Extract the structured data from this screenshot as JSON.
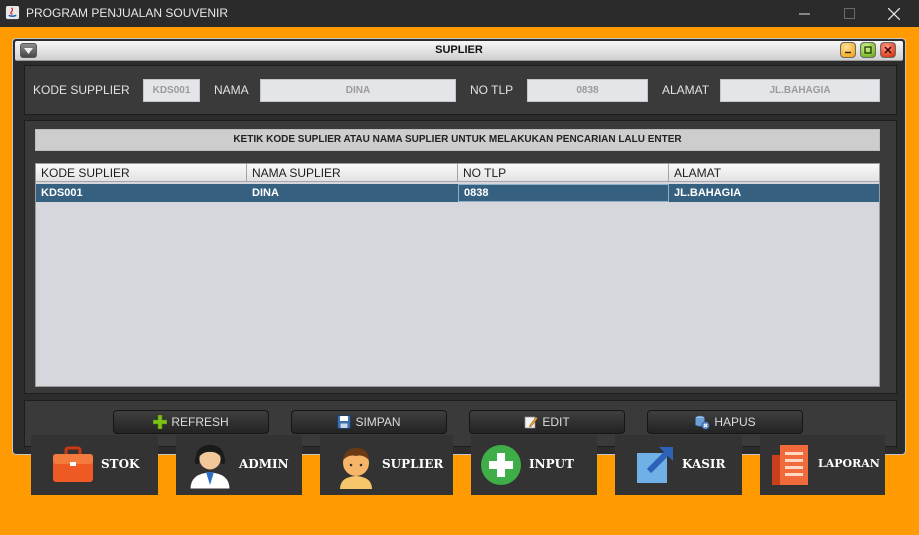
{
  "window": {
    "title": "PROGRAM PENJUALAN SOUVENIR"
  },
  "frame": {
    "title": "SUPLIER"
  },
  "form": {
    "kode_label": "KODE SUPPLIER",
    "kode_value": "KDS001",
    "nama_label": "NAMA",
    "nama_value": "DINA",
    "tlp_label": "NO TLP",
    "tlp_value": "0838",
    "alamat_label": "ALAMAT",
    "alamat_value": "JL.BAHAGIA"
  },
  "search_hint": "KETIK KODE SUPLIER ATAU NAMA SUPLIER UNTUK MELAKUKAN PENCARIAN LALU ENTER",
  "table": {
    "columns": [
      "KODE SUPLIER",
      "NAMA SUPLIER",
      "NO TLP",
      "ALAMAT"
    ],
    "rows": [
      [
        "KDS001",
        "DINA",
        "0838",
        "JL.BAHAGIA"
      ]
    ]
  },
  "actions": {
    "refresh": "REFRESH",
    "simpan": "SIMPAN",
    "edit": "EDIT",
    "hapus": "HAPUS"
  },
  "menu": {
    "stok": "STOK",
    "admin": "ADMIN",
    "suplier": "SUPLIER",
    "input": "INPUT",
    "kasir": "KASIR",
    "laporan": "LAPORAN"
  },
  "colors": {
    "desktop": "#ff9a00",
    "selected_row": "#35607f",
    "panel": "#3a3a3a"
  }
}
